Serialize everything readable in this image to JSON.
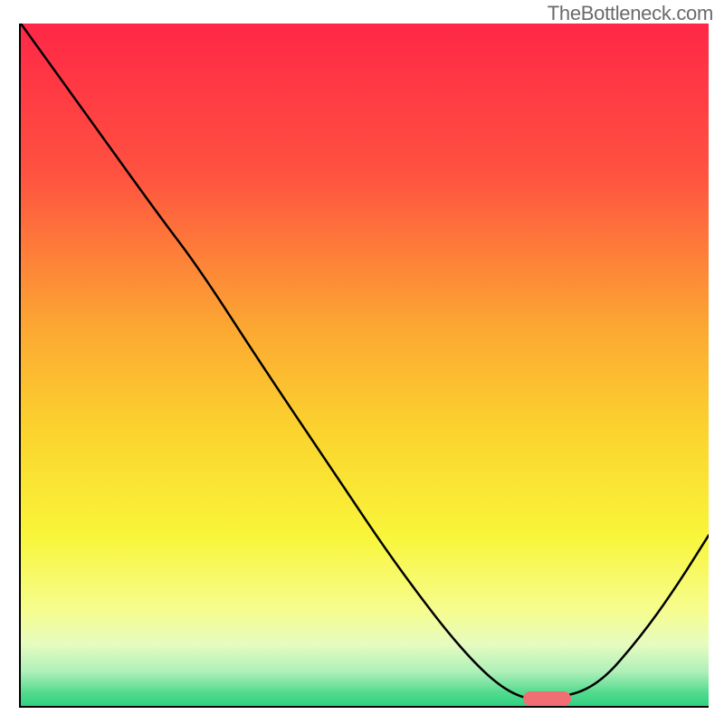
{
  "watermark": "TheBottleneck.com",
  "chart_data": {
    "type": "line",
    "title": "",
    "xlabel": "",
    "ylabel": "",
    "xlim": [
      0,
      100
    ],
    "ylim": [
      0,
      100
    ],
    "background_gradient": {
      "stops": [
        {
          "offset": 0,
          "color": "#ff2747"
        },
        {
          "offset": 22,
          "color": "#ff5240"
        },
        {
          "offset": 45,
          "color": "#fca932"
        },
        {
          "offset": 60,
          "color": "#fbd42e"
        },
        {
          "offset": 75,
          "color": "#f9f53a"
        },
        {
          "offset": 86,
          "color": "#f6fd8e"
        },
        {
          "offset": 91,
          "color": "#e6fcc0"
        },
        {
          "offset": 95,
          "color": "#aef0b9"
        },
        {
          "offset": 98,
          "color": "#54db8e"
        },
        {
          "offset": 100,
          "color": "#2fd183"
        }
      ]
    },
    "series": [
      {
        "name": "bottleneck-curve",
        "color": "#000000",
        "points": [
          {
            "x": 0,
            "y": 100
          },
          {
            "x": 10,
            "y": 86
          },
          {
            "x": 20,
            "y": 72
          },
          {
            "x": 26,
            "y": 64
          },
          {
            "x": 35,
            "y": 50
          },
          {
            "x": 45,
            "y": 35
          },
          {
            "x": 55,
            "y": 20
          },
          {
            "x": 65,
            "y": 7
          },
          {
            "x": 72,
            "y": 1
          },
          {
            "x": 78,
            "y": 1
          },
          {
            "x": 84,
            "y": 3
          },
          {
            "x": 90,
            "y": 10
          },
          {
            "x": 95,
            "y": 17
          },
          {
            "x": 100,
            "y": 25
          }
        ]
      }
    ],
    "marker": {
      "name": "optimal-range",
      "color": "#f26e75",
      "x_start": 73,
      "x_end": 80,
      "y": 1
    }
  }
}
